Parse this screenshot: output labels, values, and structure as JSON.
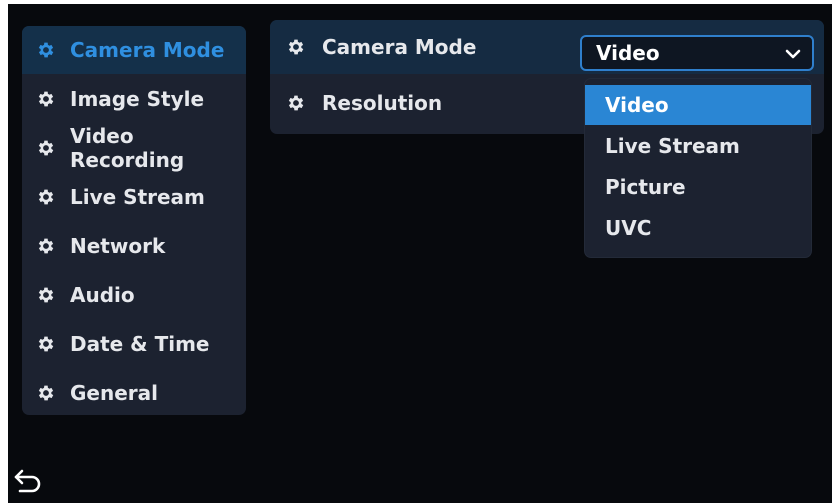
{
  "sidebar": {
    "items": [
      {
        "label": "Camera Mode",
        "active": true
      },
      {
        "label": "Image Style"
      },
      {
        "label": "Video Recording"
      },
      {
        "label": "Live Stream"
      },
      {
        "label": "Network"
      },
      {
        "label": "Audio"
      },
      {
        "label": "Date & Time"
      },
      {
        "label": "General"
      }
    ]
  },
  "panel": {
    "rows": [
      {
        "label": "Camera Mode"
      },
      {
        "label": "Resolution"
      }
    ],
    "camera_mode_select": {
      "value": "Video",
      "options": [
        "Video",
        "Live Stream",
        "Picture",
        "UVC"
      ],
      "selected_index": 0
    }
  },
  "icons": {
    "setting": "gear-icon",
    "dropdown": "chevron-down-icon",
    "back": "back-arrow-icon"
  },
  "colors": {
    "accent": "#2a86d4",
    "active_text": "#2f8fe0",
    "panel_bg": "#1c2230",
    "screen_bg": "#07090d"
  }
}
